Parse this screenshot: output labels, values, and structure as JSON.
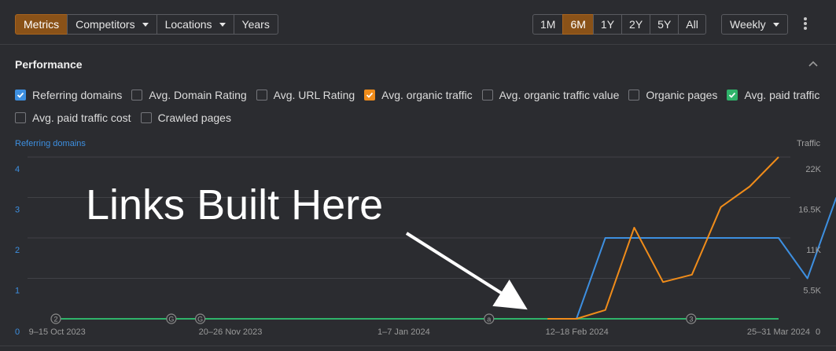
{
  "toolbar": {
    "left_tabs": [
      {
        "label": "Metrics",
        "active": true,
        "dropdown": false
      },
      {
        "label": "Competitors",
        "active": false,
        "dropdown": true
      },
      {
        "label": "Locations",
        "active": false,
        "dropdown": true
      },
      {
        "label": "Years",
        "active": false,
        "dropdown": false
      }
    ],
    "ranges": [
      {
        "label": "1M",
        "active": false
      },
      {
        "label": "6M",
        "active": true
      },
      {
        "label": "1Y",
        "active": false
      },
      {
        "label": "2Y",
        "active": false
      },
      {
        "label": "5Y",
        "active": false
      },
      {
        "label": "All",
        "active": false
      }
    ],
    "interval": "Weekly",
    "more_icon": "more-vertical-icon"
  },
  "performance": {
    "title": "Performance",
    "collapse_icon": "chevron-up-icon",
    "metrics_row1": [
      {
        "label": "Referring domains",
        "checked": true,
        "color": "#3d8fe0"
      },
      {
        "label": "Avg. Domain Rating",
        "checked": false,
        "color": ""
      },
      {
        "label": "Avg. URL Rating",
        "checked": false,
        "color": ""
      },
      {
        "label": "Avg. organic traffic",
        "checked": true,
        "color": "#f08c1a"
      },
      {
        "label": "Avg. organic traffic value",
        "checked": false,
        "color": ""
      },
      {
        "label": "Organic pages",
        "checked": false,
        "color": ""
      },
      {
        "label": "Avg. paid traffic",
        "checked": true,
        "color": "#2fb36a"
      }
    ],
    "metrics_row2": [
      {
        "label": "Avg. paid traffic cost",
        "checked": false,
        "color": ""
      },
      {
        "label": "Crawled pages",
        "checked": false,
        "color": ""
      }
    ]
  },
  "chart_data": {
    "type": "line",
    "left_axis_title": "Referring domains",
    "right_axis_title": "Traffic",
    "left_ticks": [
      "4",
      "3",
      "2",
      "1",
      "0"
    ],
    "right_ticks": [
      "22K",
      "16.5K",
      "11K",
      "5.5K",
      "0"
    ],
    "x_tick_labels": [
      {
        "label": "9–15 Oct 2023",
        "index": 1
      },
      {
        "label": "20–26 Nov 2023",
        "index": 7
      },
      {
        "label": "1–7 Jan 2024",
        "index": 13
      },
      {
        "label": "12–18 Feb 2024",
        "index": 19
      },
      {
        "label": "25–31 Mar 2024",
        "index": 25
      }
    ],
    "x_count": 26,
    "left_ylim": [
      0,
      4
    ],
    "right_ylim": [
      0,
      22000
    ],
    "series": [
      {
        "name": "Referring domains",
        "axis": "left",
        "color": "#3d8fe0",
        "x_start": 18,
        "values": [
          0,
          2,
          2,
          2,
          2,
          2,
          2,
          2,
          1,
          3
        ]
      },
      {
        "name": "Avg. organic traffic",
        "axis": "right",
        "color": "#f08c1a",
        "x_start": 17,
        "values": [
          0,
          0,
          1200,
          12400,
          5000,
          6000,
          15200,
          18000,
          22000
        ]
      },
      {
        "name": "Avg. paid traffic",
        "axis": "right",
        "color": "#2fb36a",
        "x_start": 0,
        "values": [
          0,
          0,
          0,
          0,
          0,
          0,
          0,
          0,
          0,
          0,
          0,
          0,
          0,
          0,
          0,
          0,
          0,
          0,
          0,
          0,
          0,
          0,
          0,
          0,
          0,
          0
        ]
      }
    ],
    "event_markers": [
      {
        "label": "2",
        "index": 0
      },
      {
        "label": "G",
        "index": 4
      },
      {
        "label": "G",
        "index": 5
      },
      {
        "label": "a",
        "index": 15
      },
      {
        "label": "3",
        "index": 22
      }
    ],
    "annotation": {
      "text": "Links Built Here"
    }
  }
}
